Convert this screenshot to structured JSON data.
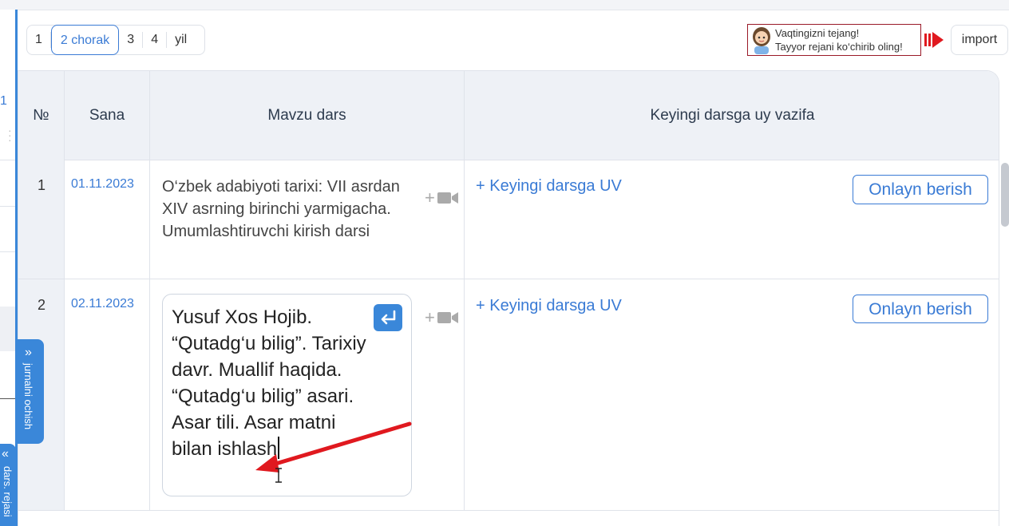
{
  "quarters": {
    "items": [
      "1",
      "2 chorak",
      "3",
      "4",
      "yil"
    ],
    "active_index": 1
  },
  "promo": {
    "line1": "Vaqtingizni tejang!",
    "line2": "Tayyor rejani ko‘chirib oling!"
  },
  "import_label": "import",
  "left_panel": {
    "partial_number": "1"
  },
  "table": {
    "headers": {
      "no": "№",
      "date": "Sana",
      "topic": "Mavzu dars",
      "homework": "Keyingi darsga uy vazifa"
    },
    "rows": [
      {
        "no": "1",
        "date": "01.11.2023",
        "topic": "O‘zbek adabiyoti tarixi: VII asrdan XIV asrning birinchi yarmigacha. Umumlashtiruvchi kirish darsi",
        "homework_link": "+ Keyingi darsga UV",
        "online_button": "Onlayn berish"
      },
      {
        "no": "2",
        "date": "02.11.2023",
        "topic_editing": "Yusuf Xos Hojib. “Qutadg‘u bilig”. Tarixiy davr. Muallif haqida. “Qutadg‘u bilig” asari. Asar tili. Asar matni bilan ishlash",
        "homework_link": "+ Keyingi darsga UV",
        "online_button": "Onlayn berish"
      }
    ]
  },
  "side_tabs": {
    "journal": "jurnalni ochish",
    "plan": "dars. rejasi"
  },
  "colors": {
    "accent": "#3a87d9",
    "link": "#3a7bd5",
    "promo_border": "#9a1a28",
    "annotation_arrow": "#e0191f"
  },
  "icons": {
    "media": "video-camera-icon",
    "enter": "enter-return-icon",
    "promo_arrow": "double-arrow-right-icon",
    "chevron": "double-chevron-icon"
  }
}
